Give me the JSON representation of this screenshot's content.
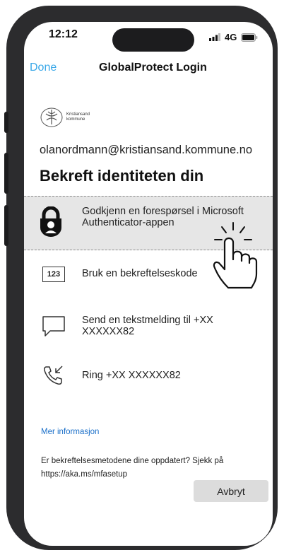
{
  "status_bar": {
    "time": "12:12",
    "network": "4G"
  },
  "nav": {
    "done_label": "Done",
    "title": "GlobalProtect Login"
  },
  "org": {
    "name_line1": "Kristiansand",
    "name_line2": "kommune"
  },
  "account_email": "olanordmann@kristiansand.kommune.no",
  "heading": "Bekreft identiteten din",
  "methods": [
    {
      "icon": "authenticator-lock-icon",
      "line1": "Godkjenn en forespørsel i Microsoft",
      "line2": "Authenticator-appen"
    },
    {
      "icon": "numeric-code-icon",
      "badge": "123",
      "line1": "Bruk en bekreftelseskode"
    },
    {
      "icon": "message-bubble-icon",
      "line1": "Send en tekstmelding til +XX",
      "line2": "XXXXXX82"
    },
    {
      "icon": "phone-call-icon",
      "line1": "Ring +XX XXXXXX82"
    }
  ],
  "more_info_link": "Mer informasjon",
  "update_note": "Er bekreftelsesmetodene dine oppdatert? Sjekk på https://aka.ms/mfasetup",
  "cancel_label": "Avbryt",
  "colors": {
    "link_blue": "#1a6fc9",
    "done_blue": "#3aa8e8",
    "selected_bg": "#e6e6e6"
  }
}
